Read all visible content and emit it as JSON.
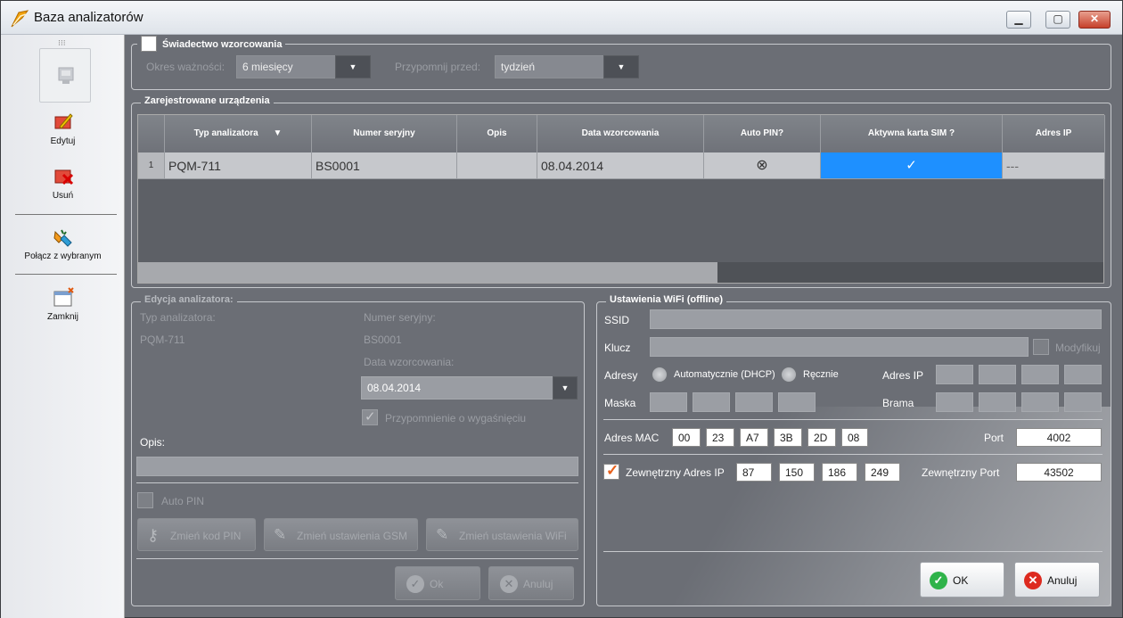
{
  "window": {
    "title": "Baza analizatorów",
    "minimize": "▁",
    "maximize": "▢",
    "close": "✕"
  },
  "sidebar": {
    "grip": "⁝⁝⁝",
    "items": [
      {
        "label": "Edytuj",
        "icon": "edit-icon"
      },
      {
        "label": "Usuń",
        "icon": "delete-icon"
      },
      {
        "label": "Połącz z wybranym",
        "icon": "connect-icon"
      },
      {
        "label": "Zamknij",
        "icon": "close-window-icon"
      }
    ]
  },
  "certificate": {
    "title": "Świadectwo wzorcowania",
    "validity_label": "Okres ważności:",
    "validity_value": "6 miesięcy",
    "remind_label": "Przypomnij przed:",
    "remind_value": "tydzień"
  },
  "devices": {
    "title": "Zarejestrowane urządzenia",
    "columns": [
      "Typ analizatora",
      "Numer seryjny",
      "Opis",
      "Data wzorcowania",
      "Auto PIN?",
      "Aktywna karta SIM ?",
      "Adres IP"
    ],
    "rows": [
      {
        "index": "1",
        "type": "PQM-711",
        "serial": "BS0001",
        "desc": "",
        "date": "08.04.2014",
        "auto_pin": "⊗",
        "sim": "✓",
        "ip": "---"
      }
    ]
  },
  "edit": {
    "title": "Edycja analizatora:",
    "type_label": "Typ analizatora:",
    "type_value": "PQM-711",
    "serial_label": "Numer seryjny:",
    "serial_value": "BS0001",
    "date_label": "Data wzorcowania:",
    "date_value": "08.04.2014",
    "reminder_label": "Przypomnienie o wygaśnięciu",
    "desc_label": "Opis:",
    "auto_pin_label": "Auto PIN",
    "btn_pin": "Zmień kod PIN",
    "btn_gsm": "Zmień ustawienia GSM",
    "btn_wifi": "Zmień ustawienia WiFi",
    "btn_ok": "Ok",
    "btn_cancel": "Anuluj"
  },
  "wifi": {
    "title": "Ustawienia WiFi (offline)",
    "ssid_label": "SSID",
    "key_label": "Klucz",
    "modify_label": "Modyfikuj",
    "addresses_label": "Adresy",
    "dhcp_label": "Automatycznie (DHCP)",
    "manual_label": "Ręcznie",
    "ip_label": "Adres IP",
    "mask_label": "Maska",
    "gateway_label": "Brama",
    "mac_label": "Adres MAC",
    "mac": [
      "00",
      "23",
      "A7",
      "3B",
      "2D",
      "08"
    ],
    "port_label": "Port",
    "port_value": "4002",
    "ext_ip_label": "Zewnętrzny Adres IP",
    "ext_ip": [
      "87",
      "150",
      "186",
      "249"
    ],
    "ext_port_label": "Zewnętrzny Port",
    "ext_port_value": "43502",
    "btn_ok": "OK",
    "btn_cancel": "Anuluj"
  }
}
